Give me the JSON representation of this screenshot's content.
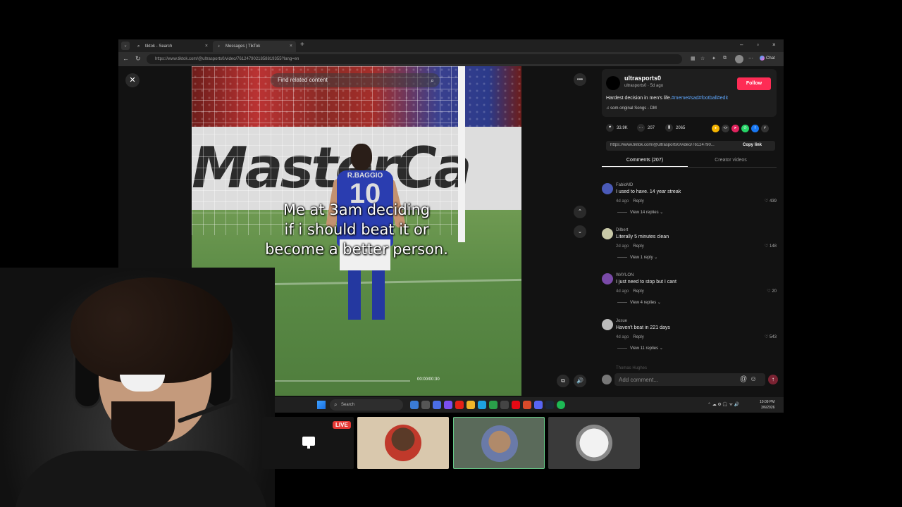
{
  "browser": {
    "tabs": [
      {
        "label": "tiktok - Search",
        "active": false
      },
      {
        "label": "Messages | TikTok",
        "active": true
      }
    ],
    "url": "https://www.tiktok.com/@ultrasports0/video/7612479021858819355?lang=en"
  },
  "video": {
    "caption_lines": [
      "Me at 3am deciding",
      "if i should beat it or",
      "become a better person."
    ],
    "find_related": "Find related content",
    "time": "00:00/00:30",
    "progress": 0.02,
    "jersey_name": "R.BAGGIO",
    "jersey_number": "10"
  },
  "creator": {
    "name": "ultrasports0",
    "sub": "ultrasports0 · 5d ago",
    "follow_label": "Follow",
    "caption": "Hardest decision in men's life.",
    "hashtags": "#meme#sad#football#edit",
    "sound": "som original Songs - DM"
  },
  "stats": {
    "likes": "33.9K",
    "comments": "207",
    "saves": "2065"
  },
  "share": {
    "link": "https://www.tiktok.com/@ultrasports0/video/76124790...",
    "copy_label": "Copy link"
  },
  "tabs": {
    "comments": "Comments (207)",
    "creator_videos": "Creator videos"
  },
  "comments": [
    {
      "user": "FabioMD",
      "text": "I used to have. 14 year streak",
      "age": "4d ago",
      "reply": "Reply",
      "likes": "439",
      "view": "View 14 replies",
      "avatar_color": "#4a5ab8"
    },
    {
      "user": "Dilbert",
      "text": "Literally 5 minutes clean",
      "age": "2d ago",
      "reply": "Reply",
      "likes": "148",
      "view": "View 1 reply",
      "avatar_color": "#c9c9a8"
    },
    {
      "user": "WAYLON",
      "text": "I just need to stop but I cant",
      "age": "4d ago",
      "reply": "Reply",
      "likes": "20",
      "view": "View 4 replies",
      "avatar_color": "#7a4aa8"
    },
    {
      "user": "Josue",
      "text": "Haven't beat in 221 days",
      "age": "4d ago",
      "reply": "Reply",
      "likes": "543",
      "view": "View 11 replies",
      "avatar_color": "#bbbbbb"
    }
  ],
  "next_comment_user": "Thomas Hughes",
  "comment_box": {
    "placeholder": "Add comment..."
  },
  "taskbar": {
    "search": "Search",
    "time": "10:09 PM",
    "date": "3/6/2026"
  },
  "stream": {
    "live_label": "LIVE"
  }
}
